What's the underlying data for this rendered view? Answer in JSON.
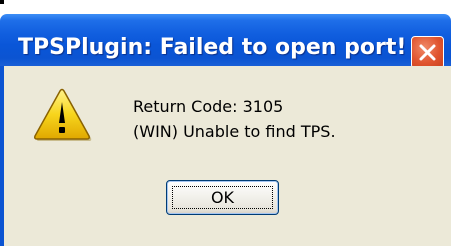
{
  "dialog": {
    "title": "TPSPlugin: Failed to open port!",
    "icon": "warning-icon",
    "message_lines": [
      "Return Code: 3105",
      "(WIN) Unable to find TPS."
    ],
    "ok_label": "OK"
  },
  "colors": {
    "titlebar": "#0b54d2",
    "close_button": "#e0542e",
    "client_background": "#ece9d8",
    "warning_fill": "#f7d51d"
  }
}
